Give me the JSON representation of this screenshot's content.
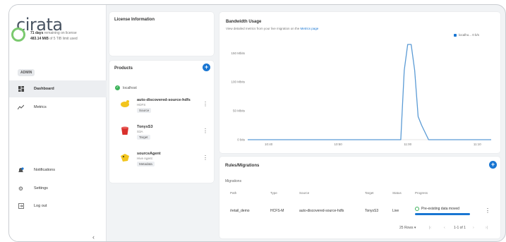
{
  "brand": {
    "logo_text": "cirata"
  },
  "sidebar": {
    "role_badge": "ADMIN",
    "items": [
      {
        "label": "Dashboard",
        "icon": "dashboard-icon",
        "active": true
      },
      {
        "label": "Metrics",
        "icon": "metrics-icon",
        "active": false
      }
    ],
    "bottom_items": [
      {
        "label": "Notifications",
        "icon": "bell-icon"
      },
      {
        "label": "Settings",
        "icon": "gear-icon"
      },
      {
        "label": "Log out",
        "icon": "logout-icon"
      }
    ],
    "collapse_glyph": "‹"
  },
  "license": {
    "title": "License Information",
    "days": "71 days",
    "days_suffix": "remaining on license",
    "used": "483.14 MiB",
    "used_suffix": "of 5 TiB limit used"
  },
  "products": {
    "title": "Products",
    "add_glyph": "+",
    "host": "localhost",
    "items": [
      {
        "name": "auto-discovered-source-hdfs",
        "type": "HDFS",
        "role": "Source",
        "icon": "hdfs-icon"
      },
      {
        "name": "TonysS3",
        "type": "S3A",
        "role": "Target",
        "icon": "s3-icon"
      },
      {
        "name": "sourceAgent",
        "type": "Hive Agent",
        "role": "Metadata",
        "icon": "hive-icon"
      }
    ]
  },
  "bandwidth": {
    "title": "Bandwidth Usage",
    "subtitle": "View detailed metrics from your live migration on the",
    "subtitle_link": "Metrics page",
    "legend": "localho... 0 b/s",
    "line_color": "#5b9bd5"
  },
  "chart_data": {
    "type": "line",
    "title": "Bandwidth Usage",
    "xlabel": "",
    "ylabel": "",
    "y_ticks": [
      "0 bits",
      "50 Mbits",
      "100 Mbits",
      "150 Mbits"
    ],
    "ylim": [
      0,
      165
    ],
    "x_ticks": [
      "10:40",
      "10:50",
      "11:00",
      "11:10"
    ],
    "x": [
      "10:37",
      "10:40",
      "10:45",
      "10:50",
      "10:55",
      "10:58",
      "10:59",
      "10:59.5",
      "11:00",
      "11:00.5",
      "11:01",
      "11:01.5",
      "11:02",
      "11:03",
      "11:05",
      "11:06",
      "11:07",
      "11:08",
      "11:09",
      "11:10",
      "11:12"
    ],
    "series": [
      {
        "name": "localho...",
        "values": [
          0,
          0,
          0,
          0,
          0,
          0,
          0,
          120,
          165,
          165,
          120,
          40,
          25,
          0,
          0,
          0,
          0,
          0,
          0,
          0,
          0
        ]
      }
    ],
    "peaks": [
      {
        "x_frac": 0.0,
        "v": 0
      }
    ],
    "grid": false,
    "legend_position": "top-right"
  },
  "rules": {
    "title": "Rules/Migrations",
    "add_glyph": "+",
    "section_label": "Migrations",
    "columns": [
      "Path",
      "Type",
      "Source",
      "Target",
      "Status",
      "Progress"
    ],
    "rows": [
      {
        "path": "/retail_demo",
        "type": "HCFS-M",
        "source": "auto-discovered-source-hdfs",
        "target": "TonysS3",
        "status": "Live",
        "progress_label": "Pre-existing data moved",
        "progress": 1.0
      }
    ],
    "rows_per_page": "25 Rows",
    "page_range": "1-1 of 1"
  }
}
